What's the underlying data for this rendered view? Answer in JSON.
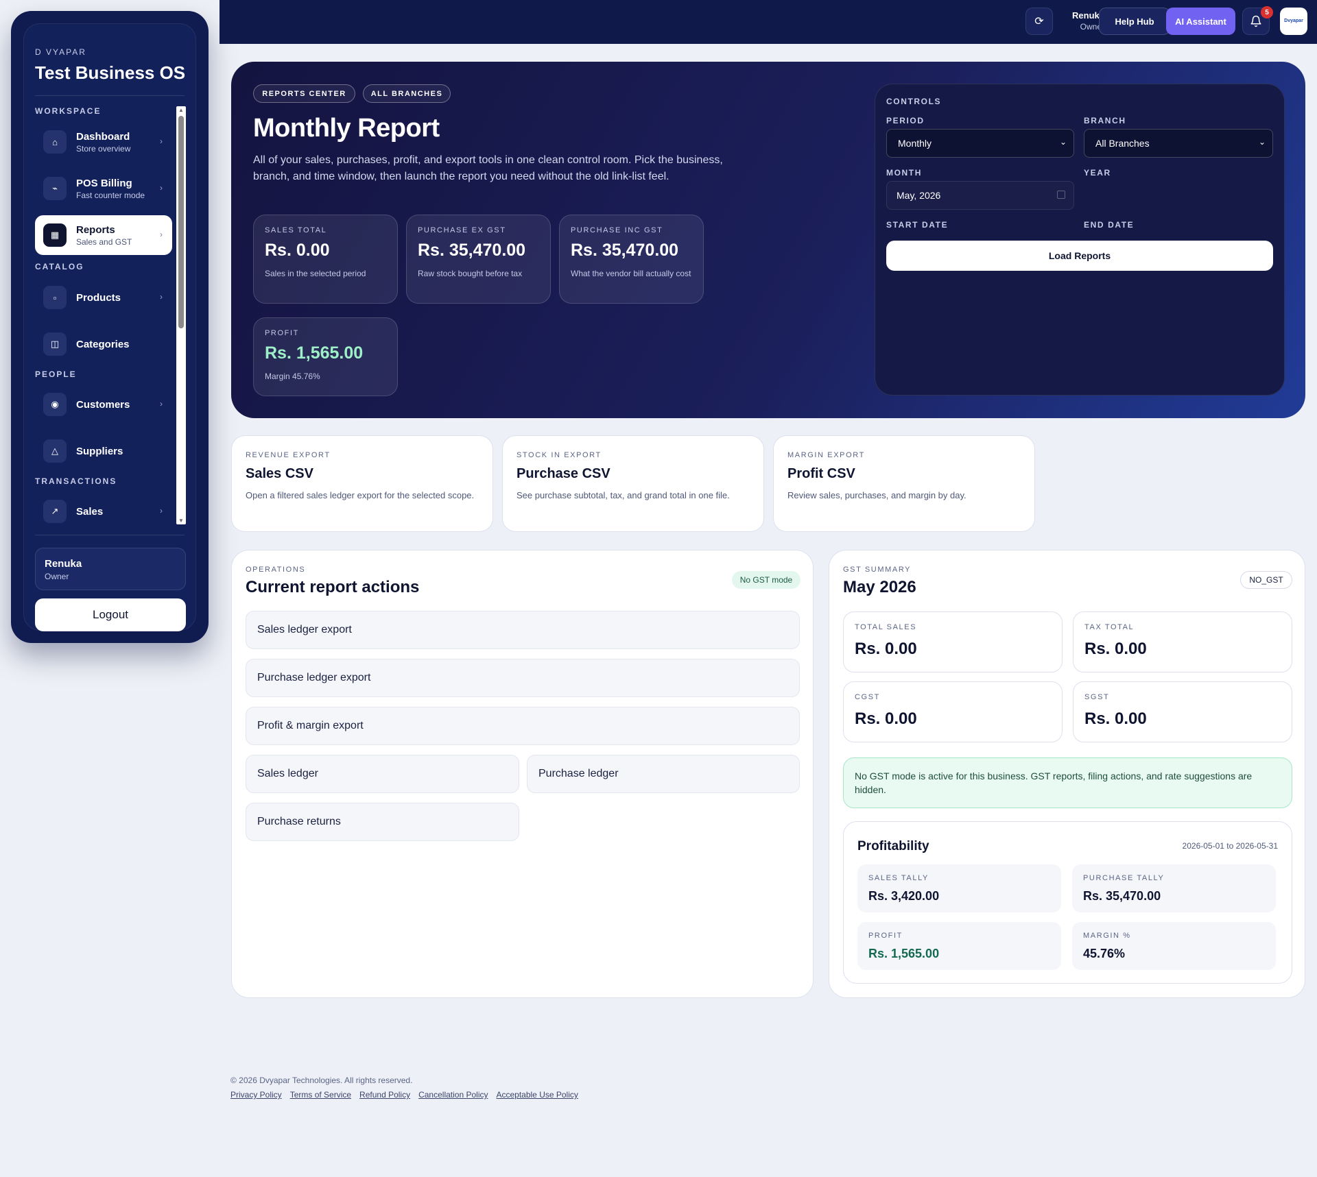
{
  "sidebar": {
    "brand_small": "D VYAPAR",
    "brand": "Test Business OS",
    "sections": [
      "WORKSPACE",
      "CATALOG",
      "PEOPLE",
      "TRANSACTIONS"
    ],
    "items": [
      {
        "label": "Dashboard",
        "sub": "Store overview",
        "icon": "home-icon"
      },
      {
        "label": "POS Billing",
        "sub": "Fast counter mode",
        "icon": "pos-icon"
      },
      {
        "label": "Reports",
        "sub": "Sales and GST",
        "icon": "reports-icon",
        "active": true
      },
      {
        "label": "Products",
        "sub": "",
        "icon": "box-icon"
      },
      {
        "label": "Categories",
        "sub": "",
        "icon": "categories-icon"
      },
      {
        "label": "Customers",
        "sub": "",
        "icon": "customers-icon"
      },
      {
        "label": "Suppliers",
        "sub": "",
        "icon": "suppliers-icon"
      },
      {
        "label": "Sales",
        "sub": "",
        "icon": "sales-icon"
      }
    ],
    "user": {
      "name": "Renuka",
      "role": "Owner"
    },
    "logout": "Logout"
  },
  "topbar": {
    "user_name": "Renuka",
    "user_role": "Owner",
    "help": "Help Hub",
    "ai": "AI Assistant",
    "notif_count": "5",
    "logo_text": "Dvyapar"
  },
  "hero": {
    "pill_1": "REPORTS CENTER",
    "pill_2": "ALL BRANCHES",
    "title": "Monthly Report",
    "desc": "All of your sales, purchases, profit, and export tools in one clean control room. Pick the business, branch, and time window, then launch the report you need without the old link-list feel.",
    "stats": [
      {
        "key": "SALES TOTAL",
        "value": "Rs. 0.00",
        "desc": "Sales in the selected period"
      },
      {
        "key": "PURCHASE EX GST",
        "value": "Rs. 35,470.00",
        "desc": "Raw stock bought before tax"
      },
      {
        "key": "PURCHASE INC GST",
        "value": "Rs. 35,470.00",
        "desc": "What the vendor bill actually cost"
      },
      {
        "key": "PROFIT",
        "value": "Rs. 1,565.00",
        "desc": "Margin 45.76%"
      }
    ]
  },
  "controls": {
    "title": "CONTROLS",
    "period_label": "PERIOD",
    "period_value": "Monthly",
    "branch_label": "BRANCH",
    "branch_value": "All Branches",
    "month_label": "MONTH",
    "month_value": "May, 2026",
    "year_label": "YEAR",
    "start_label": "START DATE",
    "end_label": "END DATE",
    "load": "Load Reports"
  },
  "exports": [
    {
      "key": "REVENUE EXPORT",
      "title": "Sales CSV",
      "desc": "Open a filtered sales ledger export for the selected scope."
    },
    {
      "key": "STOCK IN EXPORT",
      "title": "Purchase CSV",
      "desc": "See purchase subtotal, tax, and grand total in one file."
    },
    {
      "key": "MARGIN EXPORT",
      "title": "Profit CSV",
      "desc": "Review sales, purchases, and margin by day."
    }
  ],
  "operations": {
    "key": "OPERATIONS",
    "title": "Current report actions",
    "tag": "No GST mode",
    "actions": [
      "Sales ledger export",
      "Purchase ledger export",
      "Profit & margin export",
      "Sales ledger",
      "Purchase ledger",
      "Purchase returns"
    ]
  },
  "gst": {
    "key": "GST SUMMARY",
    "title": "May 2026",
    "tag": "NO_GST",
    "cards": [
      {
        "key": "TOTAL SALES",
        "value": "Rs. 0.00"
      },
      {
        "key": "TAX TOTAL",
        "value": "Rs. 0.00"
      },
      {
        "key": "CGST",
        "value": "Rs. 0.00"
      },
      {
        "key": "SGST",
        "value": "Rs. 0.00"
      }
    ],
    "note": "No GST mode is active for this business. GST reports, filing actions, and rate suggestions are hidden.",
    "profitability": {
      "title": "Profitability",
      "range": "2026-05-01 to 2026-05-31",
      "cells": [
        {
          "key": "SALES TALLY",
          "value": "Rs. 3,420.00"
        },
        {
          "key": "PURCHASE TALLY",
          "value": "Rs. 35,470.00"
        },
        {
          "key": "PROFIT",
          "value": "Rs. 1,565.00"
        },
        {
          "key": "MARGIN %",
          "value": "45.76%"
        }
      ]
    }
  },
  "footer": {
    "copyright": "© 2026 Dvyapar Technologies. All rights reserved.",
    "links": [
      "Privacy Policy",
      "Terms of Service",
      "Refund Policy",
      "Cancellation Policy",
      "Acceptable Use Policy"
    ]
  },
  "colors": {
    "navy": "#0f1a4a",
    "accent_purple": "#7262f2",
    "profit_green": "#9ef0c8",
    "note_green": "#e9faf2"
  }
}
